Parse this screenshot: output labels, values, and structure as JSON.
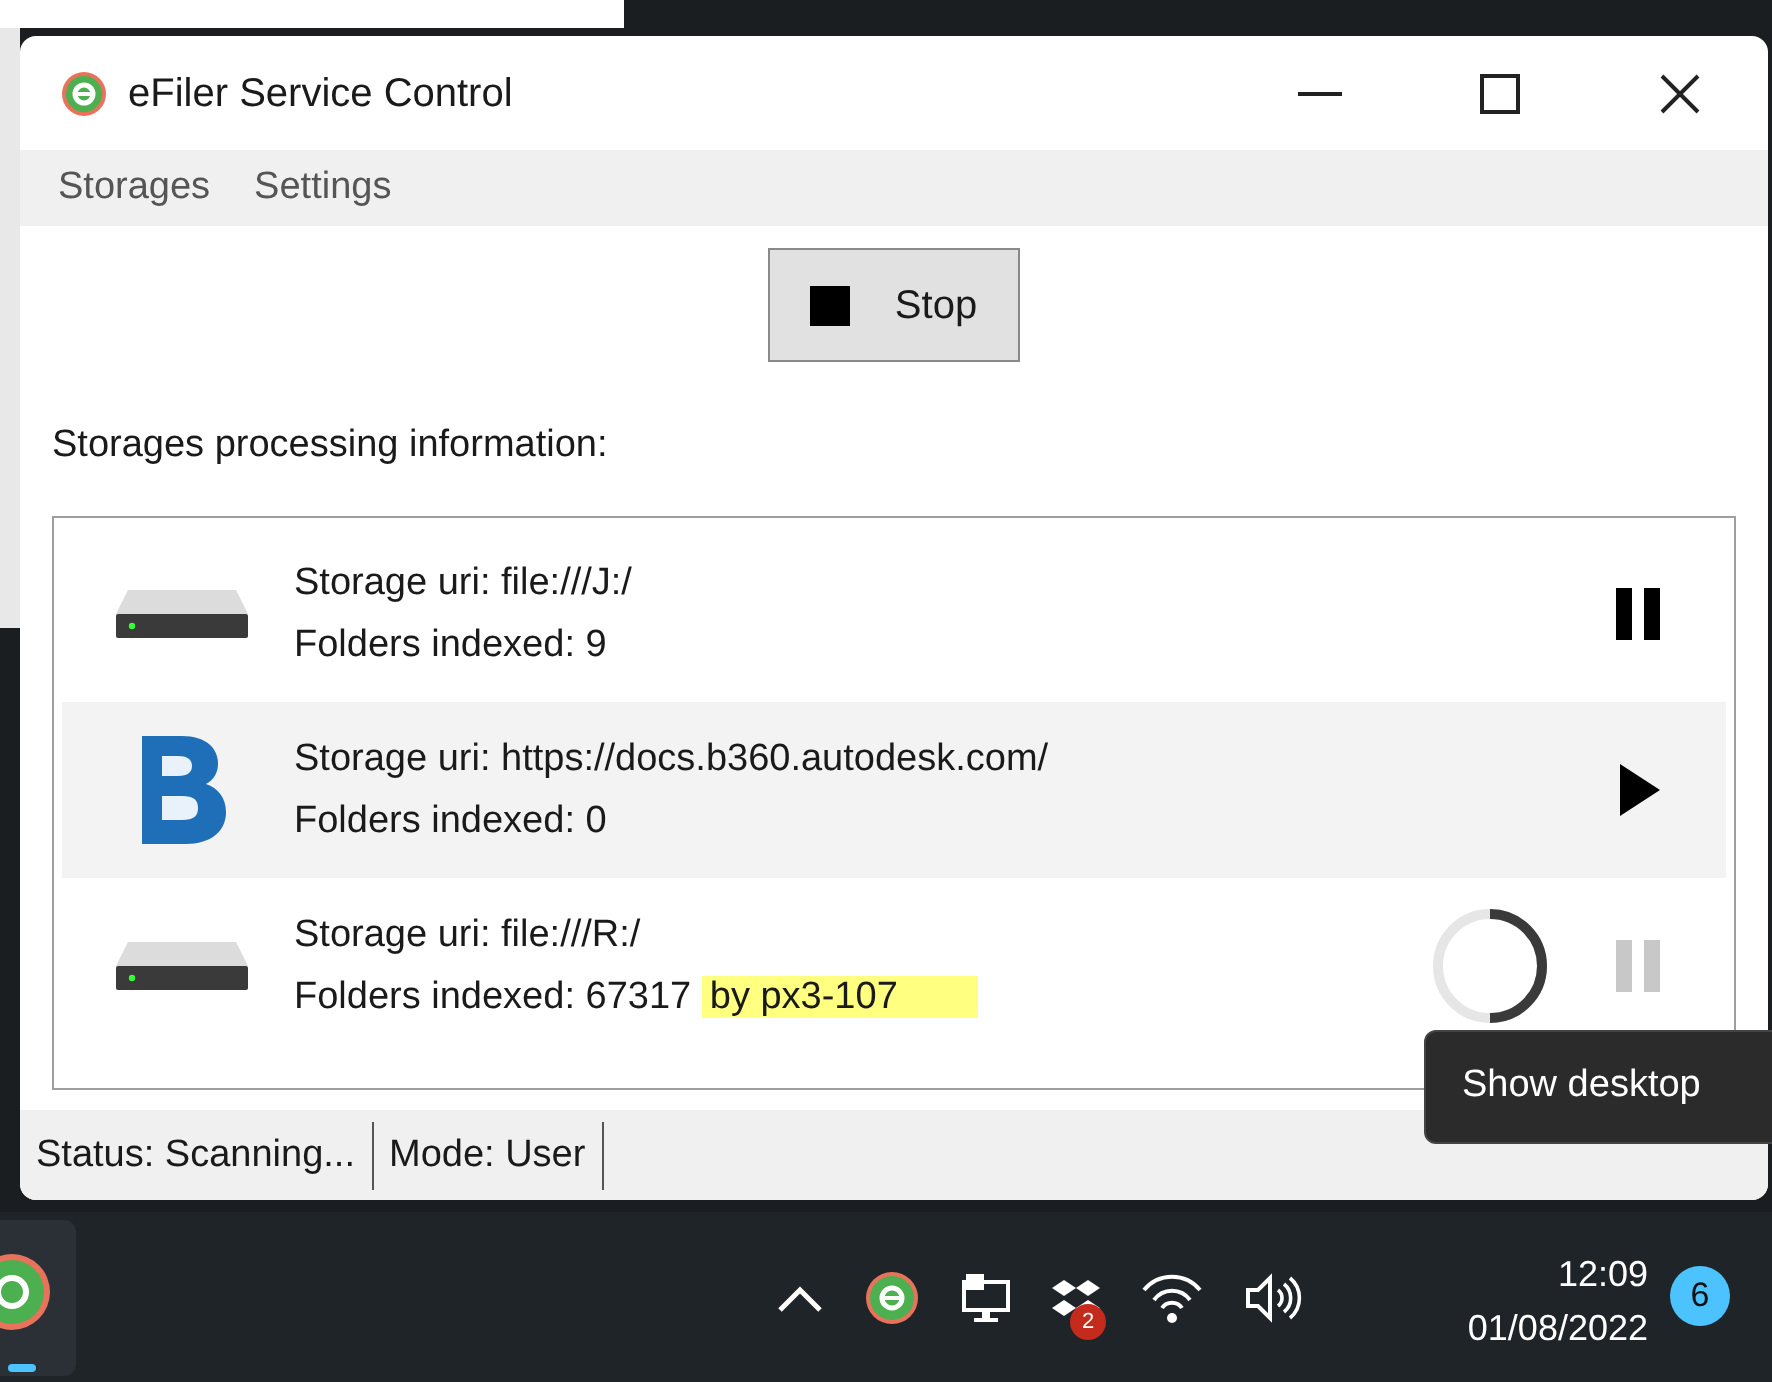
{
  "window": {
    "title": "eFiler Service Control"
  },
  "menu": [
    {
      "label": "Storages"
    },
    {
      "label": "Settings"
    }
  ],
  "stop_button": {
    "label": "Stop"
  },
  "section_label": "Storages processing information:",
  "storages": [
    {
      "kind": "drive",
      "uri": "Storage uri: file:///J:/",
      "folders": "Folders indexed: 9",
      "running": true,
      "selected": false,
      "busy": false,
      "disabled": false
    },
    {
      "kind": "cloud",
      "uri": "Storage uri: https://docs.b360.autodesk.com/",
      "folders": "Folders indexed: 0",
      "running": false,
      "selected": true,
      "busy": false,
      "disabled": false
    },
    {
      "kind": "drive",
      "uri": "Storage uri: file:///R:/",
      "folders": "Folders indexed: 67317",
      "highlight": "by px3-107",
      "running": true,
      "selected": false,
      "busy": true,
      "disabled": true
    }
  ],
  "status_bar": [
    "Status: Scanning...",
    "Mode: User"
  ],
  "tooltip": "Show desktop",
  "taskbar": {
    "tray_badge": "2",
    "time": "12:09",
    "date": "01/08/2022",
    "notification_count": "6"
  }
}
